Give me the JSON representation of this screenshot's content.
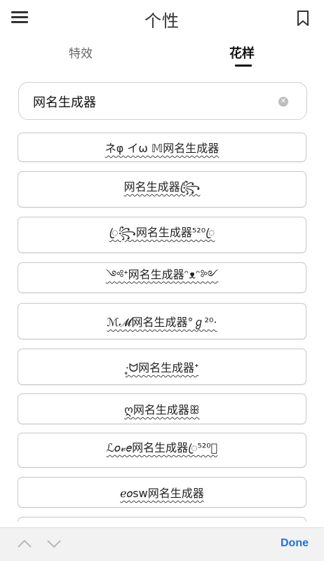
{
  "header": {
    "title": "个性"
  },
  "tabs": [
    {
      "label": "特效",
      "active": false
    },
    {
      "label": "花样",
      "active": true
    }
  ],
  "input": {
    "value": "网名生成器",
    "placeholder": ""
  },
  "results": [
    "ネφ イω 𝕄网名生成器",
    "网名生成器꧂ꦿ",
    "ꦿ꧂网名生成器⁵²⁰ꦿ",
    "༺ᕀ网名生成器ᵔᴥᵔ༻",
    "ℳ𝓜网名生成器°ℊ²⁰⋅",
    "⋅̥ᗢ网名生成器ᕀ",
    "ღ网名生成器ꕥ",
    "ℒ𝑜𝓋𝑒网名生成器ꦿ⁵²⁰ꦿ",
    "ℯ𝑜sw网名生成器",
    ""
  ],
  "accessory": {
    "done_label": "Done"
  },
  "colors": {
    "accent": "#1a73e8",
    "text": "#222222",
    "border": "#c8c8c8",
    "bar": "#f2f2f2"
  },
  "icons": {
    "menu": "menu-icon",
    "bookmark": "bookmark-icon",
    "clear": "clear-icon",
    "up": "chevron-up-icon",
    "down": "chevron-down-icon"
  }
}
